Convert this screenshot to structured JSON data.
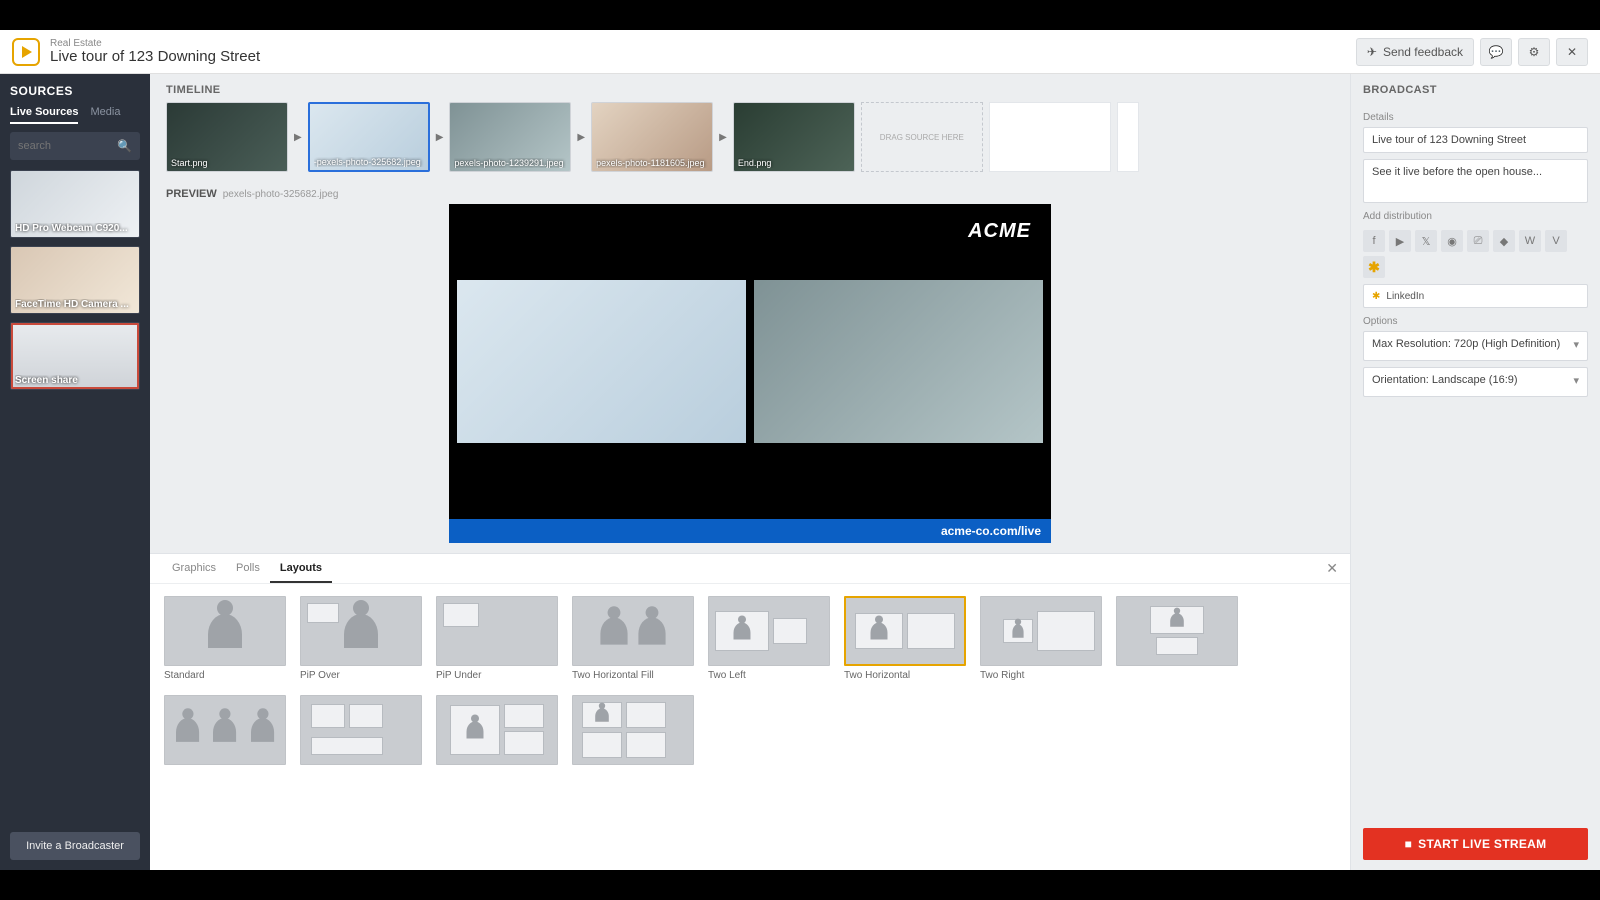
{
  "header": {
    "category": "Real Estate",
    "title": "Live tour of 123 Downing Street",
    "send_feedback": "Send feedback"
  },
  "sidebar": {
    "title": "SOURCES",
    "tabs": {
      "live": "Live Sources",
      "media": "Media"
    },
    "search_placeholder": "search",
    "sources": [
      {
        "label": "HD Pro Webcam C920...",
        "active": false
      },
      {
        "label": "FaceTime HD Camera ...",
        "active": false
      },
      {
        "label": "Screen share",
        "active": true
      }
    ],
    "invite": "Invite a Broadcaster"
  },
  "timeline": {
    "title": "TIMELINE",
    "items": [
      {
        "label": "Start.png",
        "selected": false
      },
      {
        "label": "-pexels-photo-325682.jpeg",
        "selected": true
      },
      {
        "label": "pexels-photo-1239291.jpeg",
        "selected": false
      },
      {
        "label": "pexels-photo-1181605.jpeg",
        "selected": false
      },
      {
        "label": "End.png",
        "selected": false
      }
    ],
    "drop_hint": "DRAG SOURCE HERE"
  },
  "preview": {
    "title": "PREVIEW",
    "filename": "pexels-photo-325682.jpeg",
    "brand": "ACME",
    "footer_url": "acme-co.com/live"
  },
  "bottom": {
    "tabs": {
      "graphics": "Graphics",
      "polls": "Polls",
      "layouts": "Layouts"
    },
    "layouts": [
      {
        "label": "Standard",
        "selected": false
      },
      {
        "label": "PiP Over",
        "selected": false
      },
      {
        "label": "PiP Under",
        "selected": false
      },
      {
        "label": "Two Horizontal Fill",
        "selected": false
      },
      {
        "label": "Two Left",
        "selected": false
      },
      {
        "label": "Two Horizontal",
        "selected": true
      },
      {
        "label": "Two Right",
        "selected": false
      },
      {
        "label": "",
        "selected": false
      },
      {
        "label": "",
        "selected": false
      },
      {
        "label": "",
        "selected": false
      },
      {
        "label": "",
        "selected": false
      },
      {
        "label": "",
        "selected": false
      }
    ]
  },
  "broadcast": {
    "title": "BROADCAST",
    "details_label": "Details",
    "name_value": "Live tour of 123 Downing Street",
    "desc_value": "See it live before the open house...",
    "dist_label": "Add distribution",
    "linkedin_label": "LinkedIn",
    "options_label": "Options",
    "resolution": "Max Resolution: 720p (High Definition)",
    "orientation": "Orientation: Landscape (16:9)",
    "start_button": "START LIVE STREAM"
  }
}
